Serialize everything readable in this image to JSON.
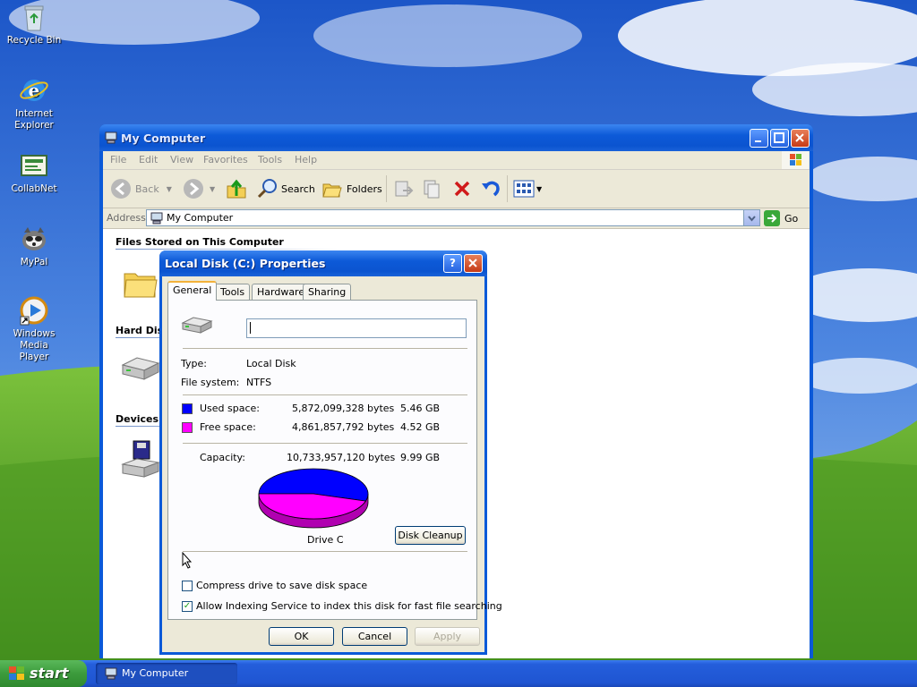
{
  "desktop": {
    "icons": [
      {
        "label": "Recycle Bin"
      },
      {
        "label_line1": "Internet",
        "label_line2": "Explorer"
      },
      {
        "label": "CollabNet"
      },
      {
        "label": "MyPal"
      },
      {
        "label_line1": "Windows Media",
        "label_line2": "Player"
      }
    ]
  },
  "explorer": {
    "title": "My Computer",
    "menu": [
      "File",
      "Edit",
      "View",
      "Favorites",
      "Tools",
      "Help"
    ],
    "toolbar": {
      "back": "Back",
      "search": "Search",
      "folders": "Folders"
    },
    "address": {
      "label": "Address",
      "value": "My Computer",
      "go": "Go"
    },
    "sections": {
      "files": "Files Stored on This Computer",
      "hard_disk": "Hard Disk",
      "devices": "Devices"
    }
  },
  "dialog": {
    "title": "Local Disk (C:) Properties",
    "tabs": [
      "General",
      "Tools",
      "Hardware",
      "Sharing"
    ],
    "active_tab": "General",
    "volume_label_value": "",
    "type_label": "Type:",
    "type_value": "Local Disk",
    "fs_label": "File system:",
    "fs_value": "NTFS",
    "used_label": "Used space:",
    "used_bytes": "5,872,099,328 bytes",
    "used_gb": "5.46 GB",
    "free_label": "Free space:",
    "free_bytes": "4,861,857,792 bytes",
    "free_gb": "4.52 GB",
    "capacity_label": "Capacity:",
    "capacity_bytes": "10,733,957,120 bytes",
    "capacity_gb": "9.99 GB",
    "drive_label": "Drive C",
    "used_fraction": 0.547,
    "cleanup_button": "Disk Cleanup",
    "compress_label": "Compress drive to save disk space",
    "compress_checked": false,
    "index_label": "Allow Indexing Service to index this disk for fast file searching",
    "index_checked": true,
    "ok": "OK",
    "cancel": "Cancel",
    "apply": "Apply"
  },
  "colors": {
    "used": "#0000ff",
    "free": "#ff00ff",
    "title_blue": "#0b54d0"
  },
  "taskbar": {
    "start": "start",
    "task": "My Computer"
  }
}
